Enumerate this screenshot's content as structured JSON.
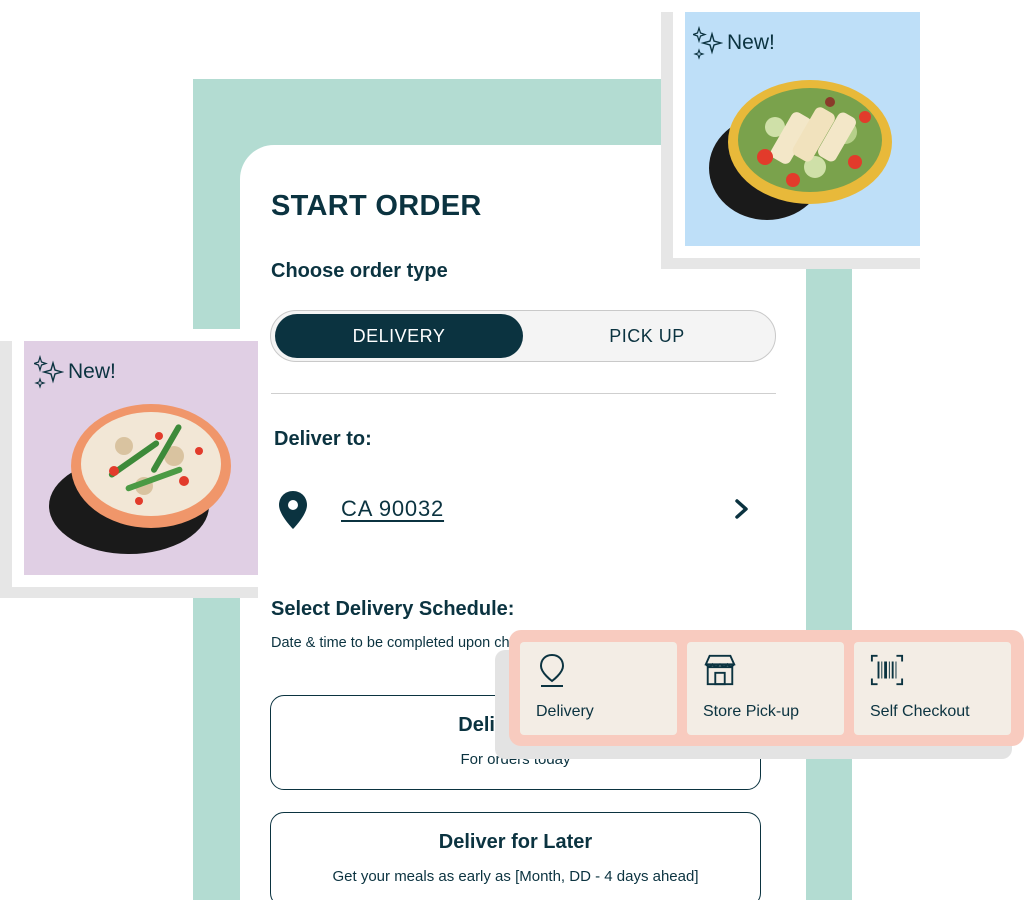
{
  "order": {
    "title": "START ORDER",
    "choose_type_label": "Choose order type",
    "order_types": {
      "delivery": "DELIVERY",
      "pickup": "PICK UP",
      "selected": "DELIVERY"
    },
    "deliver_to_label": "Deliver to:",
    "address": "CA 90032",
    "schedule": {
      "title": "Select Delivery Schedule:",
      "note": "Date & time to be completed upon checkout.",
      "options": [
        {
          "heading": "Deliver Now",
          "sub": "For orders today"
        },
        {
          "heading": "Deliver for Later",
          "sub": "Get your meals as early as [Month, DD - 4 days ahead]"
        }
      ]
    }
  },
  "promos": [
    {
      "badge": "New!",
      "icon": "sparkle-icon",
      "bg": "#bedff8"
    },
    {
      "badge": "New!",
      "icon": "sparkle-icon",
      "bg": "#e0cfe4"
    }
  ],
  "quick_options": [
    {
      "label": "Delivery",
      "icon": "location-pin-icon"
    },
    {
      "label": "Store Pick-up",
      "icon": "storefront-icon"
    },
    {
      "label": "Self Checkout",
      "icon": "barcode-scan-icon"
    }
  ],
  "colors": {
    "primary": "#0b3340",
    "teal_band": "#b3dcd2",
    "popup_bg": "#f8cbbf",
    "tile_bg": "#f3ede5"
  }
}
